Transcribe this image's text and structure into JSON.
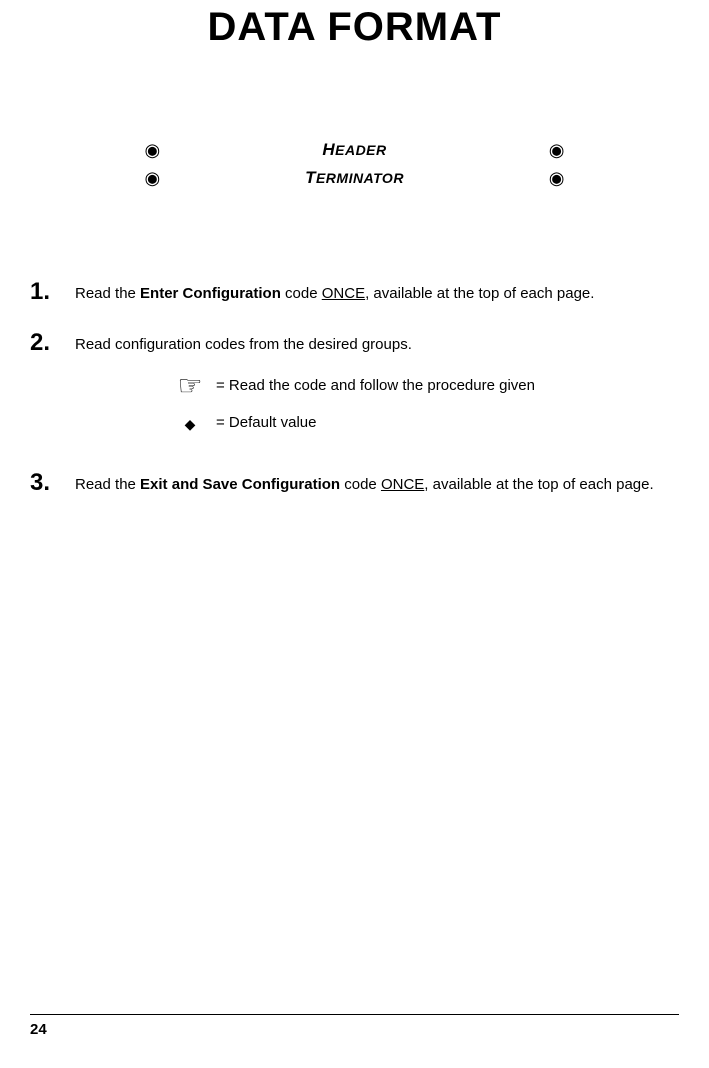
{
  "title": "DATA FORMAT",
  "toc": [
    {
      "label_first": "H",
      "label_rest": "EADER"
    },
    {
      "label_first": "T",
      "label_rest": "ERMINATOR"
    }
  ],
  "steps": {
    "s1": {
      "num": "1.",
      "pre": "Read the ",
      "bold": "Enter Configuration",
      "mid": " code ",
      "underline": "ONCE",
      "post": ", available at the top of each page."
    },
    "s2": {
      "num": "2.",
      "text": "Read configuration codes from the desired groups.",
      "legend": {
        "hand": "= Read the code and follow the procedure given",
        "diamond": "= Default value"
      }
    },
    "s3": {
      "num": "3.",
      "pre": "Read the ",
      "bold": "Exit and Save Configuration",
      "mid": " code ",
      "underline": "ONCE",
      "post": ", available at the top of each page."
    }
  },
  "pageNumber": "24"
}
